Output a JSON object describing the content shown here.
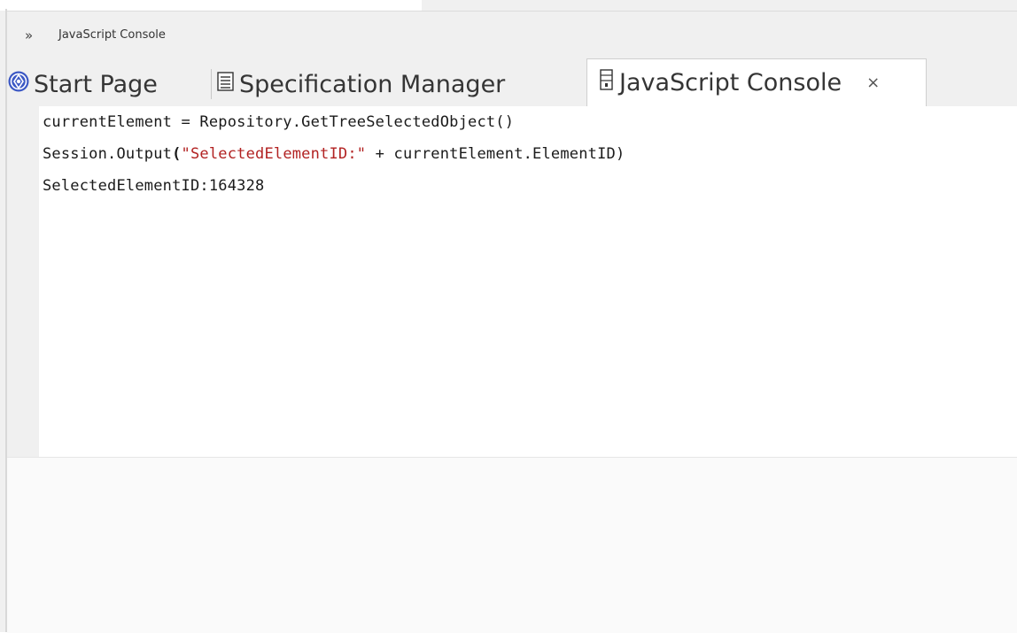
{
  "panel": {
    "title": "JavaScript Console",
    "expand_icon": "double-chevron-right-icon"
  },
  "tabs": [
    {
      "label": "Start Page",
      "icon": "start-page-icon",
      "active": false
    },
    {
      "label": "Specification Manager",
      "icon": "specification-list-icon",
      "active": false
    },
    {
      "label": "JavaScript Console",
      "icon": "console-document-icon",
      "active": true,
      "close_label": "×"
    }
  ],
  "console": {
    "lines": [
      {
        "text": "currentElement = Repository.GetTreeSelectedObject()"
      },
      {
        "prefix": "Session.Output",
        "open": "(",
        "string": "\"SelectedElementID:\"",
        "suffix": " + currentElement.ElementID)"
      },
      {
        "text": "SelectedElementID:164328"
      }
    ]
  },
  "colors": {
    "string": "#b22222",
    "background": "#f0f0f0",
    "console_bg": "#ffffff"
  }
}
